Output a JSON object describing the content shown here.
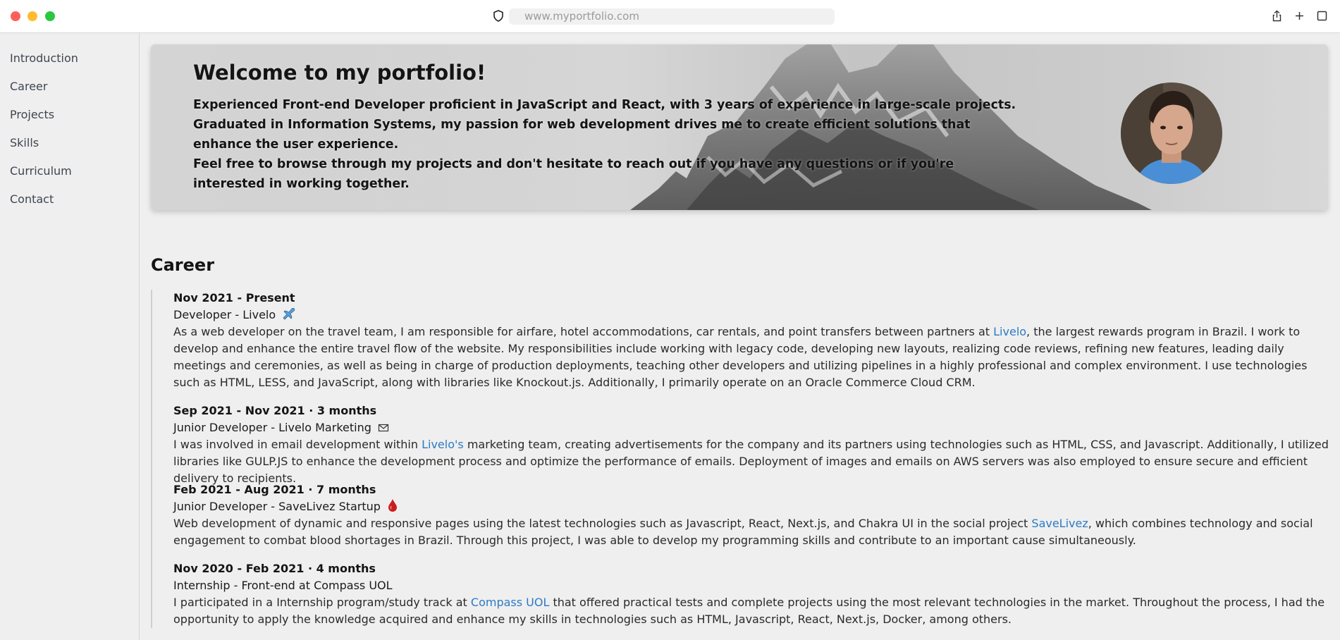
{
  "browser": {
    "url": "www.myportfolio.com"
  },
  "sidebar": {
    "items": [
      {
        "label": "Introduction"
      },
      {
        "label": "Career"
      },
      {
        "label": "Projects"
      },
      {
        "label": "Skills"
      },
      {
        "label": "Curriculum"
      },
      {
        "label": "Contact"
      }
    ]
  },
  "hero": {
    "title": "Welcome to my portfolio!",
    "line1": "Experienced Front-end Developer proficient in JavaScript and React, with 3 years of experience in large-scale projects.",
    "line2": "Graduated in Information Systems, my passion for web development drives me to create efficient solutions that enhance the user experience.",
    "line3": "Feel free to browse through my projects and don't hesitate to reach out if you have any questions or if you're interested in working together."
  },
  "career": {
    "title": "Career",
    "jobs": [
      {
        "date": "Nov 2021 - Present",
        "role": "Developer - Livelo",
        "desc_before": "As a web developer on the travel team, I am responsible for airfare, hotel accommodations, car rentals, and point transfers between partners at ",
        "link": "Livelo",
        "desc_after": ", the largest rewards program in Brazil. I work to develop and enhance the entire travel flow of the website. My responsibilities include working with legacy code, developing new layouts, realizing code reviews, refining new features, leading daily meetings and ceremonies, as well as being in charge of production deployments, teaching other developers and utilizing pipelines in a highly professional and complex environment. I use technologies such as HTML, LESS, and JavaScript, along with libraries like Knockout.js. Additionally, I primarily operate on an Oracle Commerce Cloud CRM."
      },
      {
        "date": "Sep 2021 - Nov 2021 · 3 months",
        "role": "Junior Developer - Livelo Marketing",
        "desc_before": "I was involved in email development within ",
        "link": "Livelo's",
        "desc_after": " marketing team, creating advertisements for the company and its partners using technologies such as HTML, CSS, and Javascript. Additionally, I utilized libraries like GULP.JS to enhance the development process and optimize the performance of emails. Deployment of images and emails on AWS servers was also employed to ensure secure and efficient delivery to recipients."
      },
      {
        "date": "Feb 2021 - Aug 2021 · 7 months",
        "role": "Junior Developer - SaveLivez Startup",
        "desc_before": "Web development of dynamic and responsive pages using the latest technologies such as Javascript, React, Next.js, and Chakra UI in the social project ",
        "link": "SaveLivez",
        "desc_after": ", which combines technology and social engagement to combat blood shortages in Brazil. Through this project, I was able to develop my programming skills and contribute to an important cause simultaneously."
      },
      {
        "date": "Nov 2020 - Feb 2021 · 4 months",
        "role": "Internship - Front-end at Compass UOL",
        "desc_before": "I participated in a Internship program/study track at ",
        "link": "Compass UOL",
        "desc_after": " that offered practical tests and complete projects using the most relevant technologies in the market. Throughout the process, I had the opportunity to apply the knowledge acquired and enhance my skills in technologies such as HTML, Javascript, React, Next.js, Docker, among others."
      }
    ]
  },
  "icons": {
    "job1": "airplane-emoji",
    "job2": "envelope-emoji",
    "job3": "blood-drop-emoji"
  },
  "colors": {
    "link": "#2c7bc5",
    "background": "#efefef"
  }
}
